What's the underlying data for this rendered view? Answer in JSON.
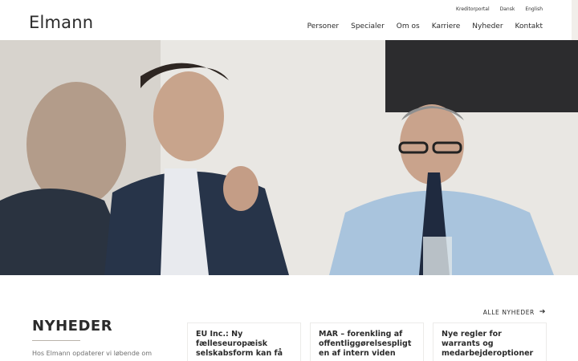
{
  "header": {
    "logo": "Elmann",
    "utility_links": [
      "Kreditorportal",
      "Dansk",
      "English"
    ],
    "nav_items": [
      "Personer",
      "Specialer",
      "Om os",
      "Karriere",
      "Nyheder",
      "Kontakt"
    ]
  },
  "hero": {
    "image_description": "Three men in business attire laughing in a meeting room"
  },
  "news": {
    "heading": "NYHEDER",
    "intro": "Hos Elmann opdaterer vi løbende om aktuelle emner inden for det…",
    "all_news_label": "ALLE NYHEDER",
    "articles": [
      {
        "title": "EU Inc.: Ny fælleseuropæisk selskabsform kan få"
      },
      {
        "title": "MAR – forenkling af offentliggørelsespligt en af intern viden"
      },
      {
        "title": "Nye regler for warrants og medarbejderoptioner"
      }
    ]
  }
}
